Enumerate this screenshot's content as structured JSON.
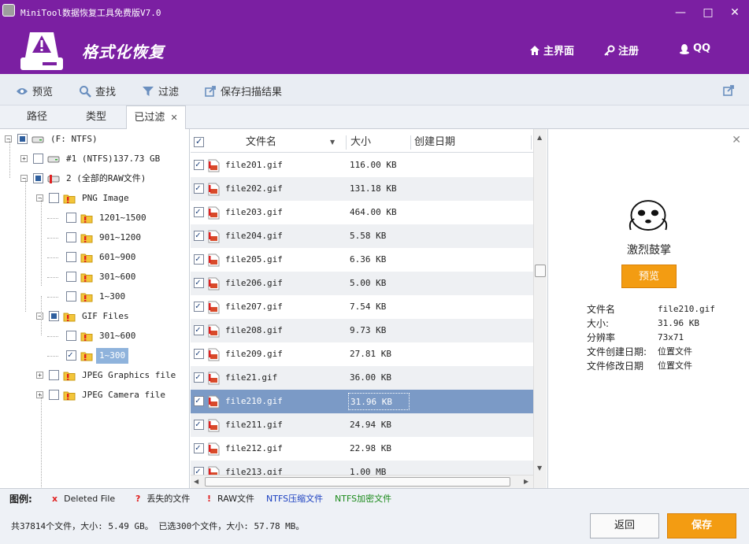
{
  "window": {
    "title": "MiniTool数据恢复工具免费版V7.0",
    "controls": {
      "minimize": "—",
      "maximize": "□",
      "close": "✕"
    }
  },
  "header": {
    "title": "格式化恢复",
    "nav": [
      {
        "label": "主界面",
        "icon": "home-icon"
      },
      {
        "label": "注册",
        "icon": "key-icon"
      },
      {
        "label": "QQ",
        "icon": "qq-icon"
      }
    ]
  },
  "toolbar": {
    "preview": "预览",
    "find": "查找",
    "filter": "过滤",
    "save_scan": "保存扫描结果"
  },
  "tabs": {
    "path": "路径",
    "type": "类型",
    "filtered": "已过滤",
    "close": "✕"
  },
  "tree": {
    "items": [
      {
        "label": "(F: NTFS)",
        "level": 0,
        "check": "partial",
        "expander": "−",
        "icon": "drive-icon"
      },
      {
        "label": "#1 (NTFS)137.73 GB",
        "level": 1,
        "check": "none",
        "expander": "+",
        "icon": "drive-icon"
      },
      {
        "label": "2 (全部的RAW文件)",
        "level": 1,
        "check": "partial",
        "expander": "−",
        "icon": "raw-drive-icon"
      },
      {
        "label": "PNG Image",
        "level": 2,
        "check": "none",
        "expander": "−",
        "icon": "folder-lost-icon"
      },
      {
        "label": "1201~1500",
        "level": 3,
        "check": "none",
        "expander": "",
        "icon": "folder-lost-icon"
      },
      {
        "label": "901~1200",
        "level": 3,
        "check": "none",
        "expander": "",
        "icon": "folder-lost-icon"
      },
      {
        "label": "601~900",
        "level": 3,
        "check": "none",
        "expander": "",
        "icon": "folder-lost-icon"
      },
      {
        "label": "301~600",
        "level": 3,
        "check": "none",
        "expander": "",
        "icon": "folder-lost-icon"
      },
      {
        "label": "1~300",
        "level": 3,
        "check": "none",
        "expander": "",
        "icon": "folder-lost-icon"
      },
      {
        "label": "GIF Files",
        "level": 2,
        "check": "partial",
        "expander": "−",
        "icon": "folder-lost-icon"
      },
      {
        "label": "301~600",
        "level": 3,
        "check": "none",
        "expander": "",
        "icon": "folder-lost-icon"
      },
      {
        "label": "1~300",
        "level": 3,
        "check": "checked",
        "expander": "",
        "icon": "folder-lost-icon",
        "selected": true
      },
      {
        "label": "JPEG Graphics file",
        "level": 2,
        "check": "none",
        "expander": "+",
        "icon": "folder-lost-icon"
      },
      {
        "label": "JPEG Camera file",
        "level": 2,
        "check": "none",
        "expander": "+",
        "icon": "folder-lost-icon"
      }
    ]
  },
  "filelist": {
    "columns": {
      "name": "文件名",
      "size": "大小",
      "created": "创建日期"
    },
    "rows": [
      {
        "name": "file201.gif",
        "size": "116.00 KB"
      },
      {
        "name": "file202.gif",
        "size": "131.18 KB"
      },
      {
        "name": "file203.gif",
        "size": "464.00 KB"
      },
      {
        "name": "file204.gif",
        "size": "5.58 KB"
      },
      {
        "name": "file205.gif",
        "size": "6.36 KB"
      },
      {
        "name": "file206.gif",
        "size": "5.00 KB"
      },
      {
        "name": "file207.gif",
        "size": "7.54 KB"
      },
      {
        "name": "file208.gif",
        "size": "9.73 KB"
      },
      {
        "name": "file209.gif",
        "size": "27.81 KB"
      },
      {
        "name": "file21.gif",
        "size": "36.00 KB"
      },
      {
        "name": "file210.gif",
        "size": "31.96 KB",
        "selected": true
      },
      {
        "name": "file211.gif",
        "size": "24.94 KB"
      },
      {
        "name": "file212.gif",
        "size": "22.98 KB"
      },
      {
        "name": "file213.gif",
        "size": "1.00 MB"
      }
    ]
  },
  "preview": {
    "close": "✕",
    "caption": "激烈鼓掌",
    "button": "预览",
    "props": [
      {
        "label": "文件名",
        "value": "file210.gif"
      },
      {
        "label": "大小:",
        "value": "31.96 KB"
      },
      {
        "label": "分辨率",
        "value": "73x71"
      },
      {
        "label": "文件创建日期:",
        "value": "位置文件"
      },
      {
        "label": "文件修改日期",
        "value": "位置文件"
      }
    ]
  },
  "legend": {
    "title": "图例:",
    "items": [
      {
        "mark": "x",
        "label": "Deleted File",
        "mark_color": "#e02020",
        "color": "#222222"
      },
      {
        "mark": "?",
        "label": "丢失的文件",
        "mark_color": "#e02020",
        "color": "#222222"
      },
      {
        "mark": "!",
        "label": "RAW文件",
        "mark_color": "#e02020",
        "color": "#222222"
      },
      {
        "mark": "",
        "label": "NTFS压缩文件",
        "mark_color": "#1a3fc0",
        "color": "#1a3fc0"
      },
      {
        "mark": "",
        "label": "NTFS加密文件",
        "mark_color": "#1a8a1a",
        "color": "#1a8a1a"
      }
    ]
  },
  "status": {
    "text": "共37814个文件，大小: 5.49 GB。 已选300个文件，大小: 57.78 MB。",
    "back": "返回",
    "save": "保存"
  },
  "colors": {
    "brand": "#7b1fa2",
    "accent": "#f39c12",
    "selection": "#7b9ac6"
  }
}
